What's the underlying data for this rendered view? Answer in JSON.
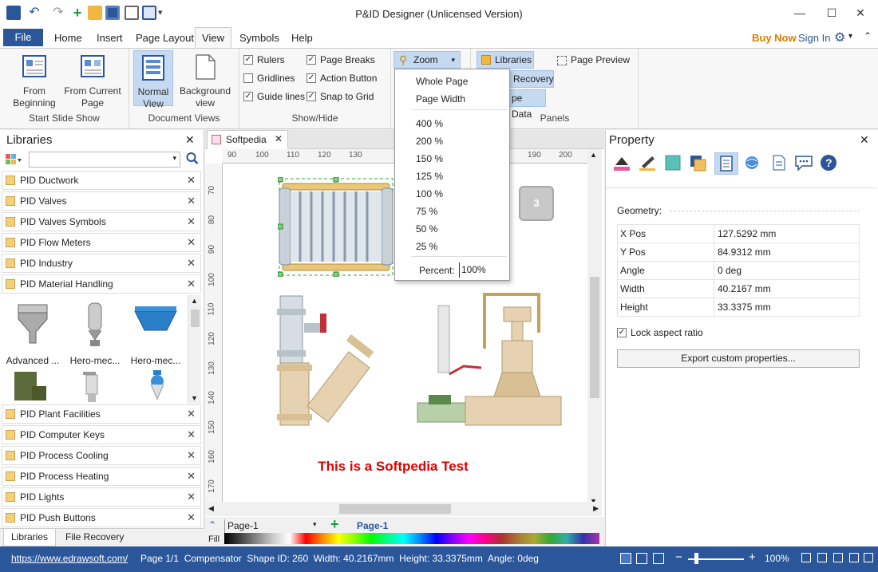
{
  "app": {
    "title": "P&ID Designer (Unlicensed Version)"
  },
  "menu": {
    "file": "File",
    "tabs": [
      "Home",
      "Insert",
      "Page Layout",
      "View",
      "Symbols",
      "Help"
    ],
    "buy_now": "Buy Now",
    "sign_in": "Sign In"
  },
  "ribbon": {
    "from_beginning": [
      "From",
      "Beginning"
    ],
    "from_current": [
      "From Current",
      "Page"
    ],
    "start_slide_show": "Start Slide Show",
    "normal_view": [
      "Normal",
      "View"
    ],
    "background_view": [
      "Background",
      "view"
    ],
    "document_views": "Document Views",
    "rulers": "Rulers",
    "page_breaks": "Page Breaks",
    "gridlines": "Gridlines",
    "action_button": "Action Button",
    "guide_lines": "Guide lines",
    "snap_to_grid": "Snap to Grid",
    "show_hide": "Show/Hide",
    "zoom": "Zoom",
    "libraries": "Libraries",
    "page_preview": "Page Preview",
    "recovery": "Recovery",
    "shape_data": "pe Data",
    "panels": "Panels"
  },
  "zoom_menu": {
    "items": [
      "Whole Page",
      "Page Width",
      "400 %",
      "200 %",
      "150 %",
      "125 %",
      "100 %",
      "75 %",
      "50 %",
      "25 %"
    ],
    "percent_label": "Percent:",
    "percent_value": "100%"
  },
  "libraries": {
    "header": "Libraries",
    "top_items": [
      "PID Ductwork",
      "PID Valves",
      "PID Valves Symbols",
      "PID Flow Meters",
      "PID Industry",
      "PID Material Handling"
    ],
    "shapes": [
      "Advanced ...",
      "Hero-mec...",
      "Hero-mec..."
    ],
    "bottom_items": [
      "PID Plant Facilities",
      "PID Computer Keys",
      "PID Process Cooling",
      "PID Process Heating",
      "PID Lights",
      "PID Push Buttons"
    ],
    "tab_libraries": "Libraries",
    "tab_file_recovery": "File Recovery"
  },
  "document": {
    "tab": "Softpedia",
    "ruler_h": [
      "90",
      "100",
      "110",
      "120",
      "130",
      "190",
      "200"
    ],
    "ruler_v": [
      "70",
      "80",
      "90",
      "100",
      "110",
      "120",
      "130",
      "140",
      "150",
      "160",
      "170"
    ],
    "key_label": "3",
    "test_text": "This is a Softpedia Test",
    "page_select": "Page-1",
    "page_tab": "Page-1",
    "fill_label": "Fill"
  },
  "property": {
    "header": "Property",
    "geometry": "Geometry:",
    "rows": [
      {
        "k": "X Pos",
        "v": "127.5292 mm"
      },
      {
        "k": "Y Pos",
        "v": "84.9312 mm"
      },
      {
        "k": "Angle",
        "v": "0 deg"
      },
      {
        "k": "Width",
        "v": "40.2167 mm"
      },
      {
        "k": "Height",
        "v": "33.3375 mm"
      }
    ],
    "lock_aspect": "Lock aspect ratio",
    "export_btn": "Export custom properties..."
  },
  "status": {
    "url": "https://www.edrawsoft.com/",
    "info": "Page 1/1  Compensator  Shape ID: 260  Width: 40.2167mm  Height: 33.3375mm  Angle: 0deg",
    "zoom": "100%"
  },
  "colors": {
    "accent": "#2b579a",
    "buy": "#e07b00",
    "test_text": "#e00000"
  }
}
